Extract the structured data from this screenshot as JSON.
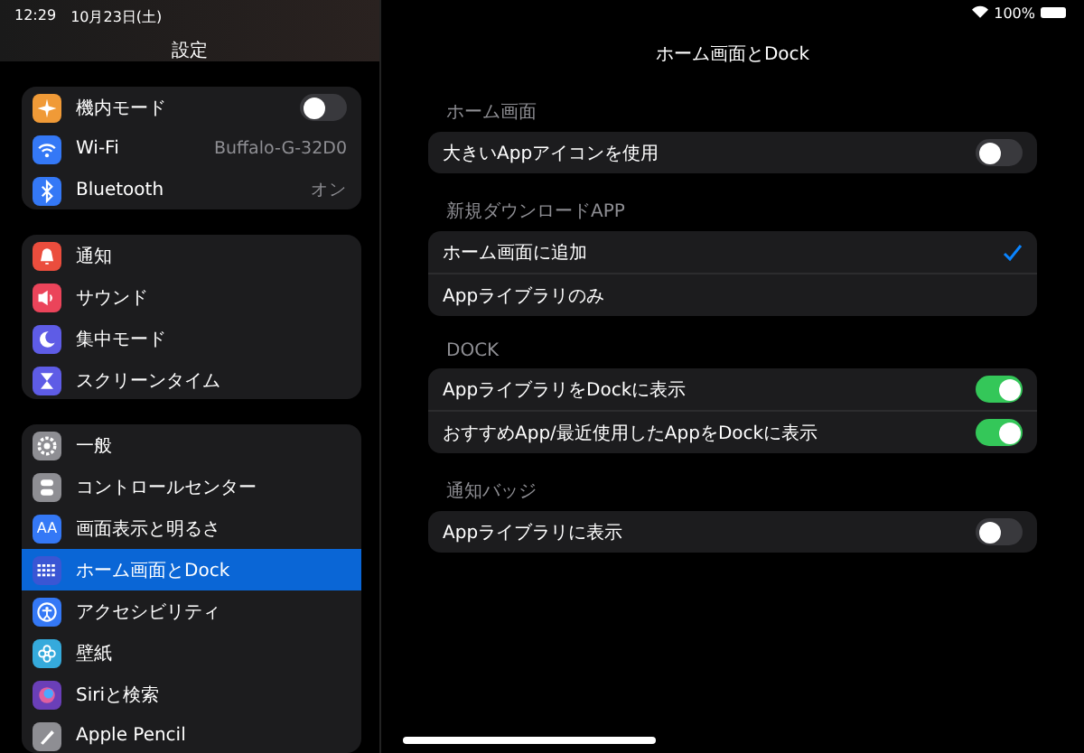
{
  "status_bar": {
    "time": "12:29",
    "date": "10月23日(土)",
    "battery": "100%"
  },
  "sidebar": {
    "title": "設定",
    "groups": [
      {
        "items": [
          {
            "label": "機内モード",
            "kind": "toggle",
            "on": false,
            "color": "#f09a37",
            "selected": false
          },
          {
            "label": "Wi-Fi",
            "kind": "value",
            "value": "Buffalo-G-32D0",
            "color": "#3478f6",
            "selected": false
          },
          {
            "label": "Bluetooth",
            "kind": "value",
            "value": "オン",
            "color": "#3478f6",
            "selected": false
          }
        ]
      },
      {
        "items": [
          {
            "label": "通知",
            "kind": "plain",
            "color": "#eb4d3d",
            "selected": false
          },
          {
            "label": "サウンド",
            "kind": "plain",
            "color": "#eb445a",
            "selected": false
          },
          {
            "label": "集中モード",
            "kind": "plain",
            "color": "#5e5ce6",
            "selected": false
          },
          {
            "label": "スクリーンタイム",
            "kind": "plain",
            "color": "#5e5ce6",
            "selected": false
          }
        ]
      },
      {
        "items": [
          {
            "label": "一般",
            "kind": "plain",
            "color": "#8e8e93",
            "selected": false
          },
          {
            "label": "コントロールセンター",
            "kind": "plain",
            "color": "#8e8e93",
            "selected": false
          },
          {
            "label": "画面表示と明るさ",
            "kind": "plain",
            "color": "#3478f6",
            "icon_label": "AA",
            "selected": false
          },
          {
            "label": "ホーム画面とDock",
            "kind": "plain",
            "color": "#3a56d4",
            "selected": true
          },
          {
            "label": "アクセシビリティ",
            "kind": "plain",
            "color": "#3478f6",
            "selected": false
          },
          {
            "label": "壁紙",
            "kind": "plain",
            "color": "#35aadc",
            "selected": false
          },
          {
            "label": "Siriと検索",
            "kind": "plain",
            "color": "#6a3fb8",
            "selected": false
          },
          {
            "label": "Apple Pencil",
            "kind": "plain",
            "color": "#8e8e93",
            "selected": false
          }
        ]
      }
    ]
  },
  "detail": {
    "title": "ホーム画面とDock",
    "sections": [
      {
        "header": "ホーム画面",
        "rows": [
          {
            "label": "大きいAppアイコンを使用",
            "kind": "toggle",
            "on": false
          }
        ]
      },
      {
        "header": "新規ダウンロードAPP",
        "rows": [
          {
            "label": "ホーム画面に追加",
            "kind": "check",
            "selected": true
          },
          {
            "label": "Appライブラリのみ",
            "kind": "check",
            "selected": false
          }
        ]
      },
      {
        "header": "DOCK",
        "rows": [
          {
            "label": "AppライブラリをDockに表示",
            "kind": "toggle",
            "on": true
          },
          {
            "label": "おすすめApp/最近使用したAppをDockに表示",
            "kind": "toggle",
            "on": true
          }
        ]
      },
      {
        "header": "通知バッジ",
        "rows": [
          {
            "label": "Appライブラリに表示",
            "kind": "toggle",
            "on": false
          }
        ]
      }
    ]
  }
}
